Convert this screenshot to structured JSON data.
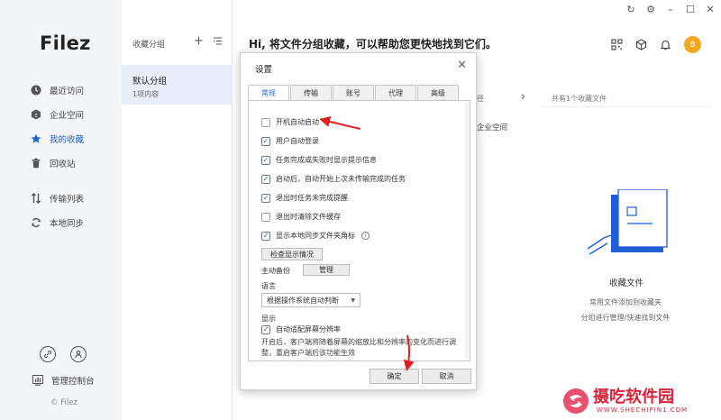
{
  "sidebar": {
    "logo": "Filez",
    "nav": [
      {
        "label": "最近访问",
        "icon": "clock-icon"
      },
      {
        "label": "企业空间",
        "icon": "enterprise-icon"
      },
      {
        "label": "我的收藏",
        "icon": "star-icon",
        "active": true
      },
      {
        "label": "回收站",
        "icon": "trash-icon"
      },
      {
        "label": "传输列表",
        "icon": "transfer-icon"
      },
      {
        "label": "本地同步",
        "icon": "sync-icon"
      }
    ],
    "admin_label": "管理控制台",
    "copyright": "© Filez"
  },
  "groups": {
    "header": "收藏分组",
    "add_symbol": "+",
    "items": [
      {
        "name": "默认分组",
        "count": "1项内容"
      }
    ]
  },
  "main": {
    "title": "Hi, 将文件分组收藏，可以帮助您更快地找到它们。",
    "avatar_text": "8",
    "partial_label_1": "径",
    "partial_label_2": "企业空间",
    "favorites_count": "共有1个收藏文件",
    "empty_title": "收藏文件",
    "empty_desc_1": "常用文件添加到收藏夹",
    "empty_desc_2": "分组进行管理/快速找到文件"
  },
  "dialog": {
    "title": "设置",
    "tabs": [
      "常规",
      "传输",
      "账号",
      "代理",
      "高级"
    ],
    "options": [
      {
        "label": "开机自动启动",
        "checked": false
      },
      {
        "label": "用户自动登录",
        "checked": true
      },
      {
        "label": "任务完成或失败时显示提示信息",
        "checked": true
      },
      {
        "label": "启动后，自动开始上次未传输完成的任务",
        "checked": true
      },
      {
        "label": "退出时任务未完成提醒",
        "checked": true
      },
      {
        "label": "退出时清除文件缓存",
        "checked": false
      },
      {
        "label": "显示本地同步文件夹角标",
        "checked": true
      }
    ],
    "check_display_button": "检查显示情况",
    "backup_label": "主动备份",
    "manage_button": "管理",
    "language_label": "语言",
    "language_value": "根据操作系统自动判断",
    "display_label": "显示",
    "dpi_option": {
      "label": "自动适配屏幕分辨率",
      "checked": true
    },
    "dpi_note": "开启后，客户端将随着屏幕的缩放比和分辨率的变化而进行调整，重启客户端后该功能生效",
    "ok_button": "确定",
    "cancel_button": "取消"
  },
  "watermark": {
    "text": "摄吃软件园",
    "sub": "WWW.SHECHIPIN1.COM"
  },
  "colors": {
    "accent": "#1e5fd8",
    "arrow": "#e02020",
    "avatar": "#f5a623"
  }
}
